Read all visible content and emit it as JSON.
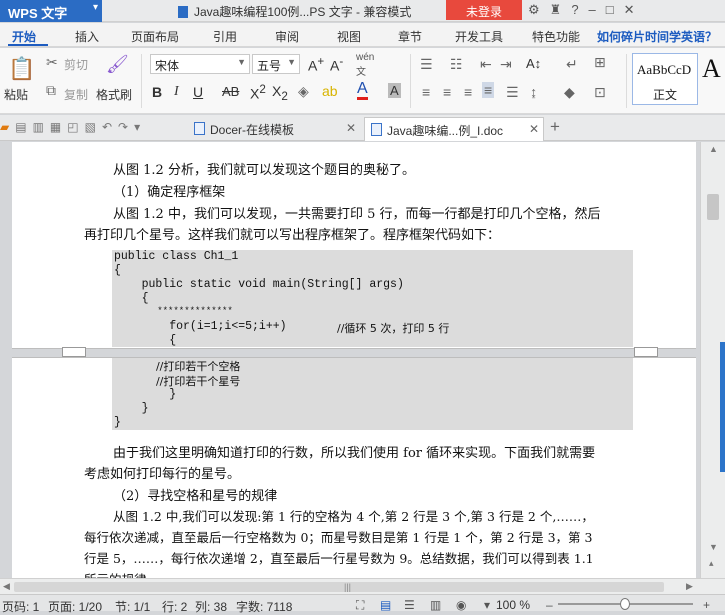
{
  "titlebar": {
    "app_name": "WPS 文字",
    "doc_title": "Java趣味编程100例...PS 文字 - 兼容模式",
    "login": "未登录"
  },
  "menu": {
    "items": [
      "开始",
      "插入",
      "页面布局",
      "引用",
      "审阅",
      "视图",
      "章节",
      "开发工具",
      "特色功能"
    ],
    "help": "如何碎片时间学英语？"
  },
  "ribbon": {
    "paste": "粘贴",
    "cut": "剪切",
    "copy": "复制",
    "format_painter": "格式刷",
    "font_name": "宋体",
    "font_size": "五号",
    "style_sample": "AaBbCcD",
    "style_name": "正文",
    "big_a": "A"
  },
  "tabs": [
    {
      "label": "Docer-在线模板"
    },
    {
      "label": "Java趣味编...例_I.doc"
    }
  ],
  "document": {
    "p1": "从图 1.2 分析，我们就可以发现这个题目的奥秘了。",
    "p2": "（1）确定程序框架",
    "p3a": "从图 1.2 中，我们可以发现，一共需要打印 5 行，而每一行都是打印几个空格，然后",
    "p3b": "再打印几个星号。这样我们就可以写出程序框架了。程序框架代码如下：",
    "code1": [
      "public class Ch1_1",
      "{",
      "    public static void main(String[] args)",
      "    {",
      "        **************",
      "        for(i=1;i<=5;i++)"
    ],
    "code1_comment": "//循环 5 次，打印 5 行",
    "code1_last": "        {",
    "code2": [
      "            //打印若干个空格",
      "            //打印若干个星号",
      "        }",
      "    }",
      "}"
    ],
    "p4a": "由于我们这里明确知道打印的行数，所以我们使用 for 循环来实现。下面我们就需要",
    "p4b": "考虑如何打印每行的星号。",
    "p5": "（2）寻找空格和星号的规律",
    "p6a": "从图 1.2 中,我们可以发现:第 1 行的空格为 4 个,第 2 行是 3 个,第 3 行是 2 个,……，",
    "p6b": "每行依次递减，直至最后一行空格数为 0；而星号数目是第 1 行是 1 个，第 2 行是 3，第 3",
    "p6c": "行是 5，……，每行依次递增 2，直至最后一行星号数为 9。总结数据，我们可以得到表 1.1",
    "p6d": "所示的规律"
  },
  "status": {
    "page": "页码: 1",
    "pages": "页面: 1/20",
    "section": "节: 1/1",
    "row": "行: 2",
    "col": "列: 38",
    "words": "字数: 7118",
    "zoom": "100 %",
    "zoom_level": 1.0
  }
}
